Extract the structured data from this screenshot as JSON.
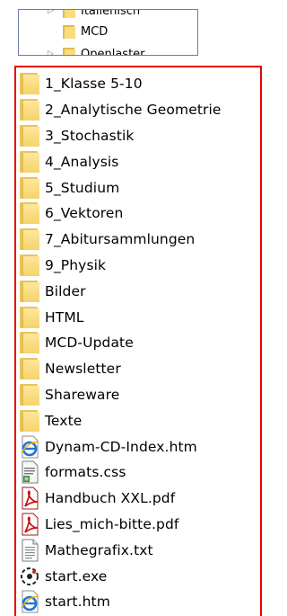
{
  "tree_top": {
    "items": [
      {
        "label": "Italienisch",
        "icon": "folder-icon",
        "expander": "chevron-right-icon"
      },
      {
        "label": "MCD",
        "icon": "folder-icon",
        "expander": ""
      },
      {
        "label": "Openlaster",
        "icon": "folder-icon",
        "expander": "chevron-right-icon"
      }
    ]
  },
  "file_list": {
    "border_color": "#e60000",
    "items": [
      {
        "label": "1_Klasse 5-10",
        "icon": "folder-icon"
      },
      {
        "label": "2_Analytische Geometrie",
        "icon": "folder-icon"
      },
      {
        "label": "3_Stochastik",
        "icon": "folder-icon"
      },
      {
        "label": "4_Analysis",
        "icon": "folder-icon"
      },
      {
        "label": "5_Studium",
        "icon": "folder-icon"
      },
      {
        "label": "6_Vektoren",
        "icon": "folder-icon"
      },
      {
        "label": "7_Abitursammlungen",
        "icon": "folder-icon"
      },
      {
        "label": "9_Physik",
        "icon": "folder-icon"
      },
      {
        "label": "Bilder",
        "icon": "folder-icon"
      },
      {
        "label": "HTML",
        "icon": "folder-icon"
      },
      {
        "label": "MCD-Update",
        "icon": "folder-icon"
      },
      {
        "label": "Newsletter",
        "icon": "folder-icon"
      },
      {
        "label": "Shareware",
        "icon": "folder-icon"
      },
      {
        "label": "Texte",
        "icon": "folder-icon"
      },
      {
        "label": "Dynam-CD-Index.htm",
        "icon": "ie-html-icon"
      },
      {
        "label": "formats.css",
        "icon": "css-file-icon"
      },
      {
        "label": "Handbuch XXL.pdf",
        "icon": "pdf-icon"
      },
      {
        "label": "Lies_mich-bitte.pdf",
        "icon": "pdf-icon"
      },
      {
        "label": "Mathegrafix.txt",
        "icon": "text-file-icon"
      },
      {
        "label": "start.exe",
        "icon": "exe-icon"
      },
      {
        "label": "start.htm",
        "icon": "ie-html-icon"
      }
    ]
  }
}
